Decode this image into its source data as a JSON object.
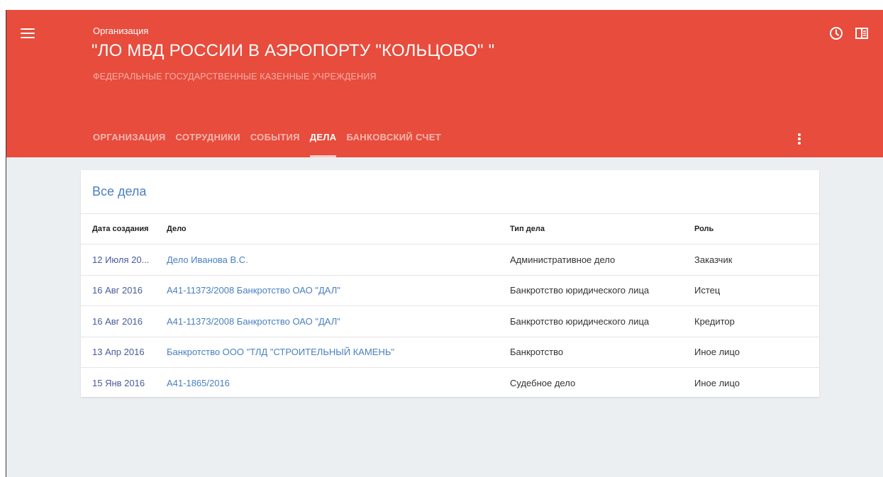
{
  "header": {
    "org_label": "Организация",
    "org_title": "\"ЛО МВД РОССИИ В АЭРОПОРТУ \"КОЛЬЦОВО\" \"",
    "org_subtitle": "ФЕДЕРАЛЬНЫЕ ГОСУДАРСТВЕННЫЕ КАЗЕННЫЕ УЧРЕЖДЕНИЯ",
    "icons": [
      "menu-icon",
      "clock-icon",
      "panel-toggle-icon",
      "more-vert-icon"
    ],
    "tabs": [
      {
        "label": "ОРГАНИЗАЦИЯ",
        "active": false
      },
      {
        "label": "СОТРУДНИКИ",
        "active": false
      },
      {
        "label": "СОБЫТИЯ",
        "active": false
      },
      {
        "label": "ДЕЛА",
        "active": true
      },
      {
        "label": "БАНКОВСКИЙ СЧЕТ",
        "active": false
      }
    ]
  },
  "cases": {
    "title": "Все дела",
    "columns": [
      "Дата создания",
      "Дело",
      "Тип дела",
      "Роль"
    ],
    "rows": [
      {
        "date": "12 Июля 20...",
        "case": "Дело Иванова В.С.",
        "type": "Административное дело",
        "role": "Заказчик"
      },
      {
        "date": "16 Авг 2016",
        "case": "А41-11373/2008 Банкротство ОАО \"ДАЛ\"",
        "type": "Банкротство юридического лица",
        "role": "Истец"
      },
      {
        "date": "16 Авг 2016",
        "case": "А41-11373/2008 Банкротство ОАО \"ДАЛ\"",
        "type": "Банкротство юридического лица",
        "role": "Кредитор"
      },
      {
        "date": "13 Апр 2016",
        "case": "Банкротство ООО \"ТЛД \"СТРОИТЕЛЬНЫЙ КАМЕНЬ\"",
        "type": "Банкротство",
        "role": "Иное лицо"
      },
      {
        "date": "15 Янв 2016",
        "case": "А41-1865/2016",
        "type": "Судебное дело",
        "role": "Иное лицо"
      }
    ]
  },
  "colors": {
    "header_bg": "#e74c3c",
    "page_bg": "#eceff1",
    "link": "#4a7fc1",
    "date": "#4a5a9c"
  }
}
